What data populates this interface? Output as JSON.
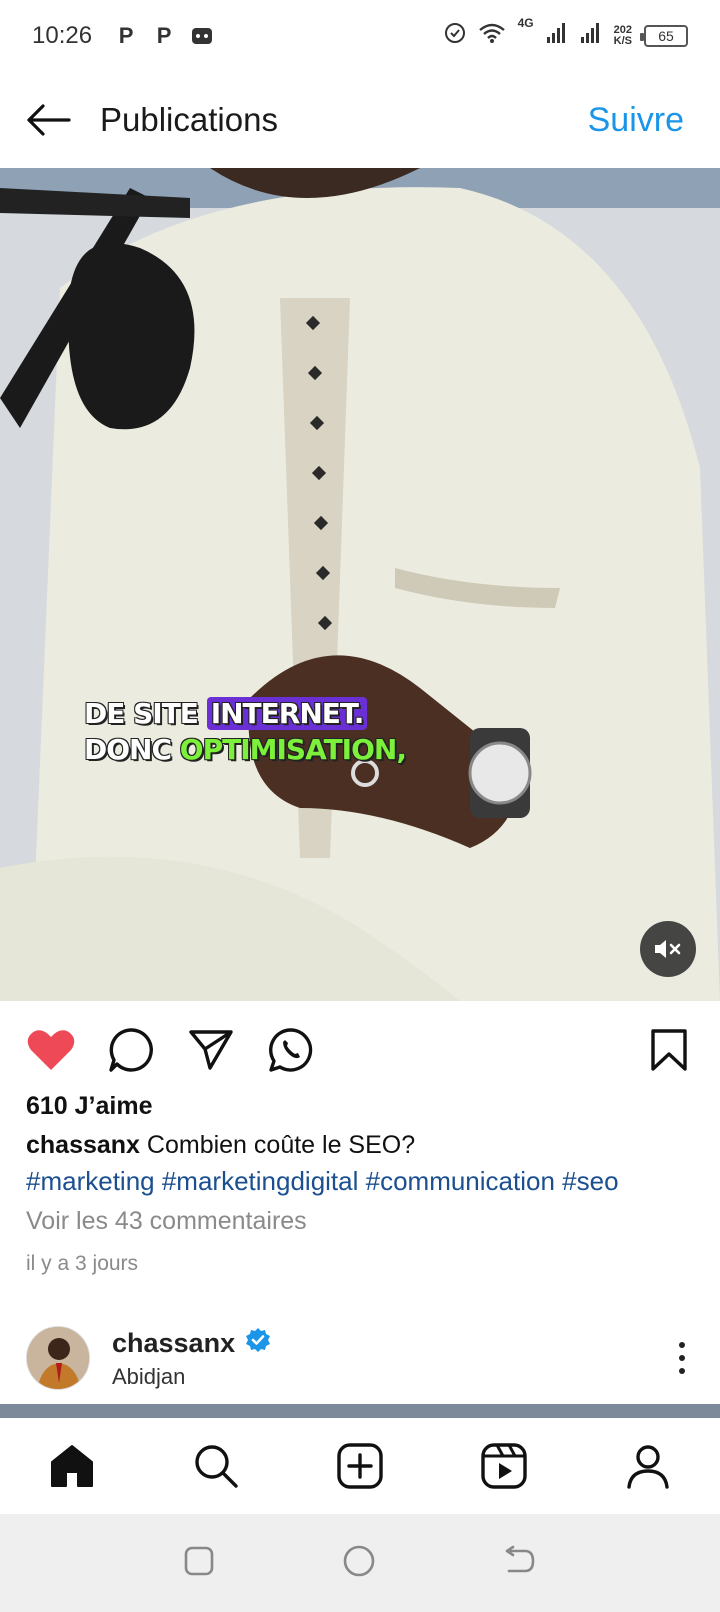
{
  "status_bar": {
    "time": "10:26",
    "network": "4G",
    "speed_value": "202",
    "speed_unit": "K/S",
    "battery": "65"
  },
  "header": {
    "title": "Publications",
    "follow_label": "Suivre",
    "accent_color": "#1b95e8"
  },
  "media": {
    "subtitle_line1_plain": "DE SITE ",
    "subtitle_line1_highlight": "INTERNET.",
    "subtitle_line2_plain": "DONC ",
    "subtitle_line2_highlight": "OPTIMISATION,"
  },
  "post": {
    "likes": "610 J’aime",
    "username": "chassanx",
    "caption": " Combien coûte le SEO?",
    "hashtags": "#marketing #marketingdigital #communication #seo",
    "comments": "Voir les 43 commentaires",
    "time_ago": "il y a 3 jours",
    "liked": true,
    "like_color": "#ed4956"
  },
  "next_post": {
    "username": "chassanx",
    "location": "Abidjan",
    "verified": true
  }
}
